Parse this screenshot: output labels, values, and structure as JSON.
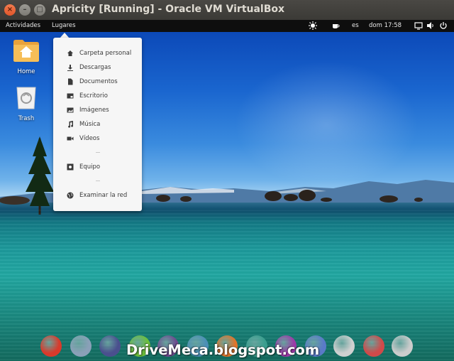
{
  "window": {
    "title": "Apricity [Running] - Oracle VM VirtualBox",
    "close_glyph": "×",
    "min_glyph": "–",
    "max_glyph": "□"
  },
  "panel": {
    "activities_label": "Actividades",
    "places_label": "Lugares",
    "language": "es",
    "clock": "dom 17:58",
    "icons": [
      "brightness-icon",
      "coffee-icon",
      "screen-icon",
      "volume-icon",
      "power-icon"
    ]
  },
  "desktop": {
    "icons": [
      {
        "label": "Home",
        "icon": "home-folder-icon"
      },
      {
        "label": "Trash",
        "icon": "trash-icon"
      }
    ]
  },
  "places_menu": {
    "items": [
      {
        "label": "Carpeta personal",
        "icon": "home-icon"
      },
      {
        "label": "Descargas",
        "icon": "download-icon"
      },
      {
        "label": "Documentos",
        "icon": "document-icon"
      },
      {
        "label": "Escritorio",
        "icon": "desktop-icon"
      },
      {
        "label": "Imágenes",
        "icon": "image-icon"
      },
      {
        "label": "Música",
        "icon": "music-icon"
      },
      {
        "label": "Vídeos",
        "icon": "video-icon"
      },
      {
        "label": "Equipo",
        "icon": "computer-icon"
      },
      {
        "label": "Examinar la red",
        "icon": "network-icon"
      }
    ]
  },
  "dock": {
    "items": [
      {
        "name": "chrome-icon",
        "color": "#d93a2b"
      },
      {
        "name": "cloud-icon",
        "color": "#8aa0b8"
      },
      {
        "name": "files-icon",
        "color": "#4a4f8e"
      },
      {
        "name": "app-green-icon",
        "color": "#6cbf3a"
      },
      {
        "name": "app-grid-icon",
        "color": "#6d4a8e"
      },
      {
        "name": "text-editor-icon",
        "color": "#4c8fb7"
      },
      {
        "name": "firefox-icon",
        "color": "#e0742a"
      },
      {
        "name": "app-teal-icon",
        "color": "#3a9e8e"
      },
      {
        "name": "app-purple-icon",
        "color": "#9c3aa8"
      },
      {
        "name": "app-blue-icon",
        "color": "#5a7ac8"
      },
      {
        "name": "settings-toggle-icon",
        "color": "#d0d0d0"
      },
      {
        "name": "installer-icon",
        "color": "#d04a4a"
      },
      {
        "name": "app-launcher-icon",
        "color": "#cccccc"
      }
    ]
  },
  "watermark": "DriveMeca.blogspot.com",
  "colors": {
    "panel_bg": "#0e0e0e",
    "menu_bg": "#f6f6f6",
    "titlebar_bg": "#3b3a36",
    "close_button": "#e0552a"
  }
}
